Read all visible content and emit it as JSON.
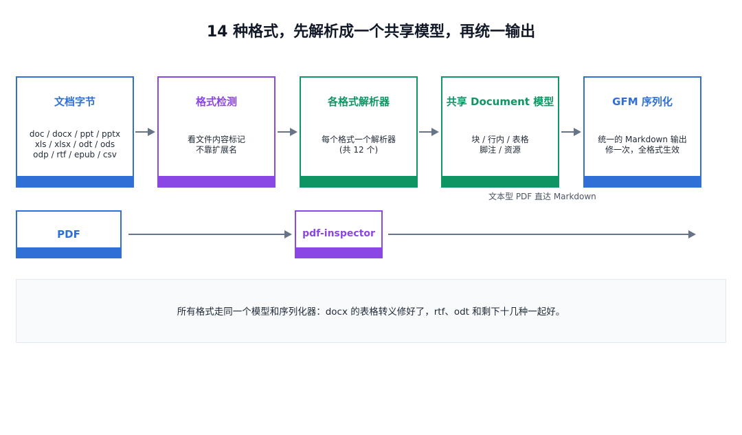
{
  "title": "14 种格式，先解析成一个共享模型，再统一输出",
  "pipeline": [
    {
      "title": "文档字节",
      "lines": [
        "doc / docx / ppt / pptx",
        "xls / xlsx / odt / ods",
        "odp / rtf / epub / csv"
      ],
      "color": "#2f6fd6"
    },
    {
      "title": "格式检测",
      "lines": [
        "看文件内容标记",
        "不靠扩展名"
      ],
      "color": "#8b47e6"
    },
    {
      "title": "各格式解析器",
      "lines": [
        "每个格式一个解析器",
        "(共 12 个)"
      ],
      "color": "#0f9564"
    },
    {
      "title": "共享 Document 模型",
      "lines": [
        "块 / 行内 / 表格",
        "脚注 / 资源"
      ],
      "color": "#0f9564"
    },
    {
      "title": "GFM 序列化",
      "lines": [
        "统一的 Markdown 输出",
        "修一次，全格式生效"
      ],
      "color": "#2f6fd6"
    }
  ],
  "pdf_path": {
    "source": "PDF",
    "inspector": "pdf-inspector",
    "note": "文本型 PDF 直达 Markdown"
  },
  "footer": "所有格式走同一个模型和序列化器：docx 的表格转义修好了，rtf、odt 和剩下十几种一起好。",
  "colors": {
    "blue": "#2f6fd6",
    "purple": "#8b47e6",
    "green": "#0f9564",
    "arrow": "#687387"
  }
}
